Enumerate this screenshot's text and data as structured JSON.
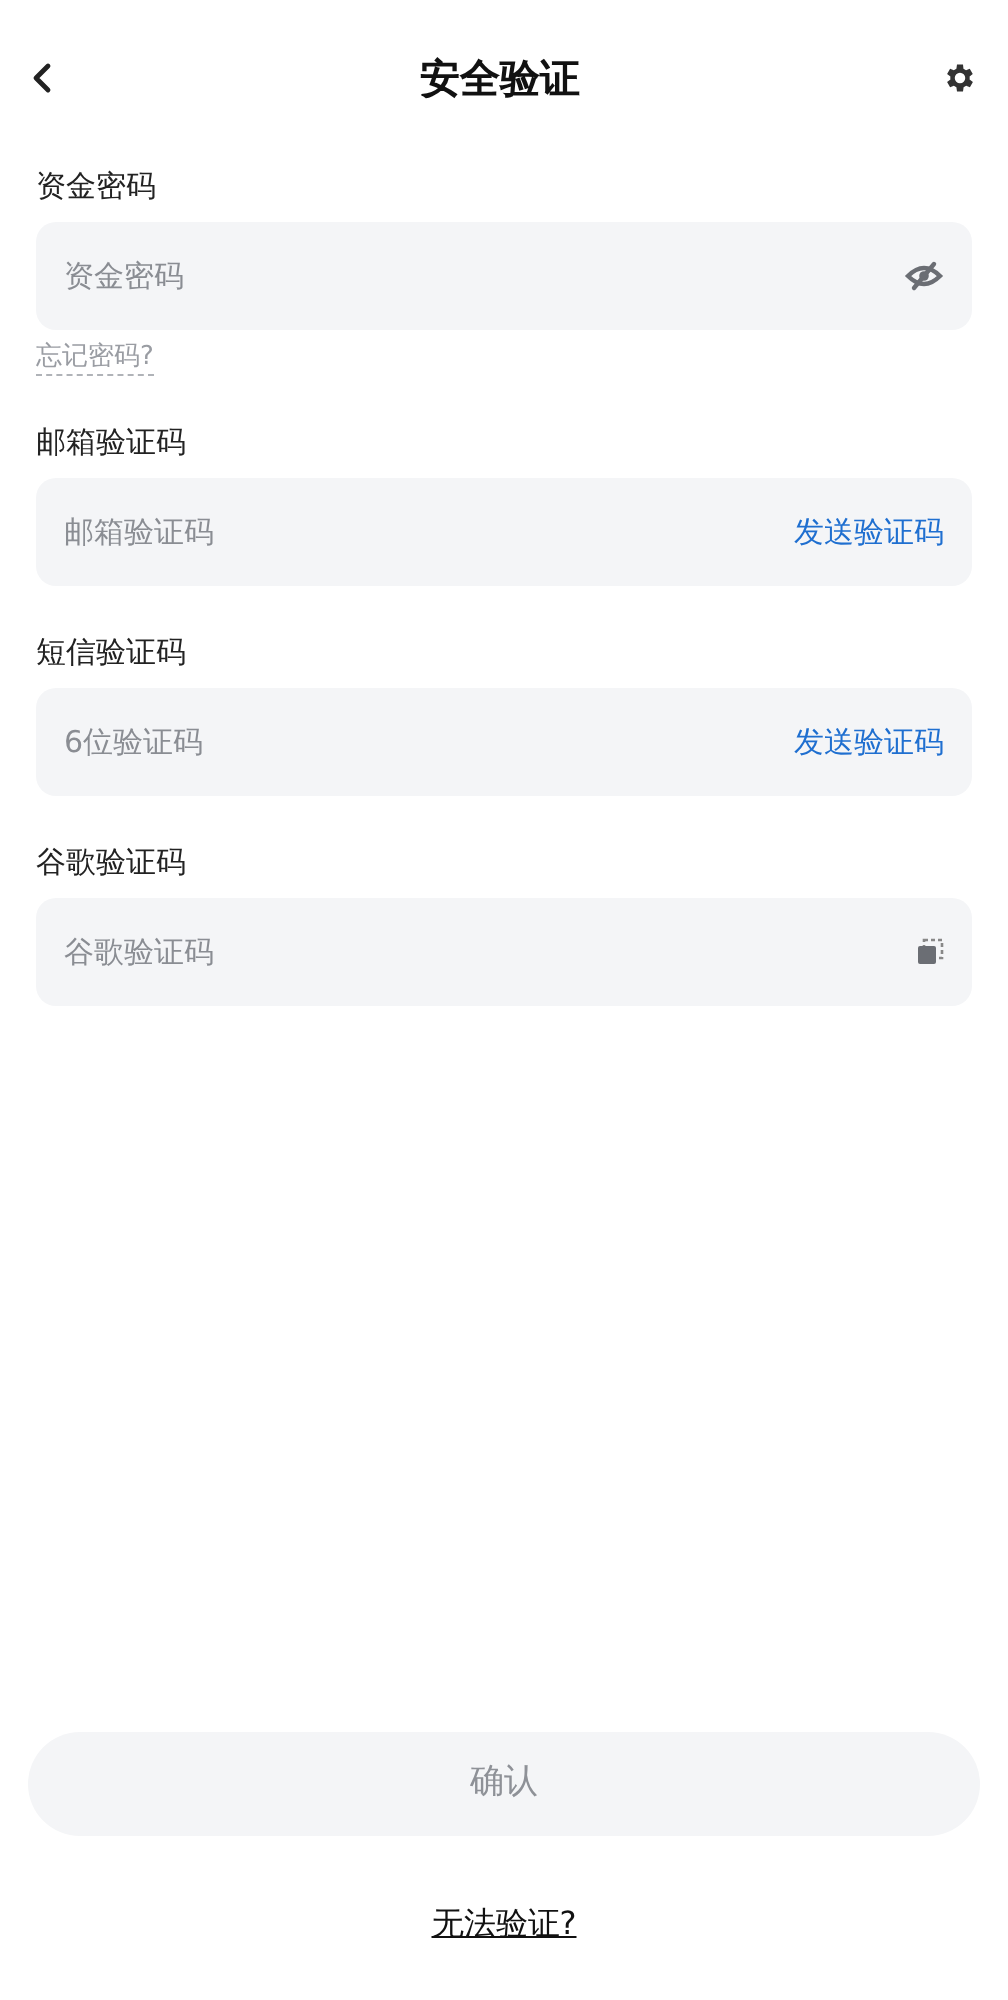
{
  "header": {
    "title": "安全验证"
  },
  "fields": [
    {
      "label": "资金密码",
      "placeholder": "资金密码",
      "kind": "password",
      "forgot": "忘记密码?"
    },
    {
      "label": "邮箱验证码",
      "placeholder": "邮箱验证码",
      "kind": "send",
      "action": "发送验证码"
    },
    {
      "label": "短信验证码",
      "placeholder": "6位验证码",
      "kind": "send",
      "action": "发送验证码"
    },
    {
      "label": "谷歌验证码",
      "placeholder": "谷歌验证码",
      "kind": "paste"
    }
  ],
  "confirm": {
    "label": "确认",
    "disabled": true
  },
  "help_link": "无法验证?"
}
